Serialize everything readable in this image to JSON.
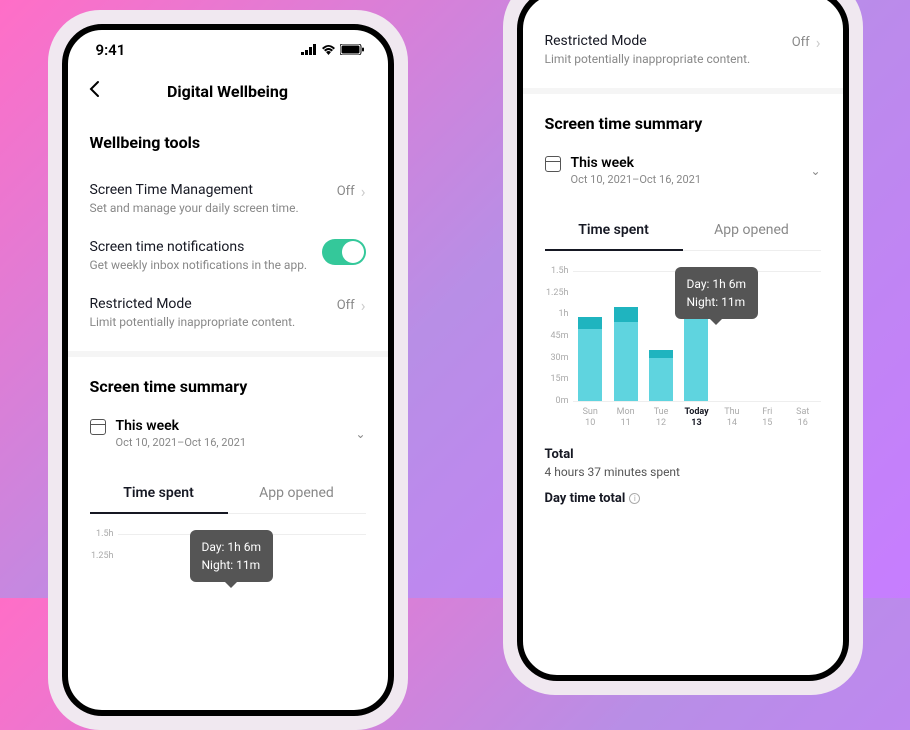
{
  "status": {
    "time": "9:41"
  },
  "header": {
    "title": "Digital Wellbeing"
  },
  "section_wellbeing": {
    "title": "Wellbeing tools",
    "items": {
      "screen_time_mgmt": {
        "label": "Screen Time Management",
        "desc": "Set and manage your daily screen time.",
        "value": "Off"
      },
      "notifications": {
        "label": "Screen time notifications",
        "desc": "Get weekly inbox notifications in the app."
      },
      "restricted": {
        "label": "Restricted Mode",
        "desc": "Limit potentially inappropriate content.",
        "value": "Off"
      }
    }
  },
  "summary": {
    "title": "Screen time summary",
    "period_label": "This week",
    "period_range": "Oct 10, 2021–Oct 16, 2021",
    "tabs": {
      "time_spent": "Time spent",
      "app_opened": "App opened"
    },
    "tooltip": {
      "day": "Day: 1h 6m",
      "night": "Night: 11m"
    },
    "totals": {
      "total_label": "Total",
      "total_value": "4 hours 37 minutes spent",
      "day_label": "Day time total"
    }
  },
  "chart_data": {
    "type": "bar",
    "title": "Time spent per day (stacked day/night, minutes)",
    "xlabel": "",
    "ylabel": "",
    "ylim": [
      0,
      90
    ],
    "y_ticks": [
      "0m",
      "15m",
      "30m",
      "45m",
      "1h",
      "1.25h",
      "1.5h"
    ],
    "categories": [
      "Sun 10",
      "Mon 11",
      "Tue 12",
      "Today 13",
      "Thu 14",
      "Fri 15",
      "Sat 16"
    ],
    "series": [
      {
        "name": "Day",
        "values": [
          50,
          55,
          30,
          66,
          0,
          0,
          0
        ]
      },
      {
        "name": "Night",
        "values": [
          8,
          10,
          5,
          11,
          0,
          0,
          0
        ]
      }
    ],
    "highlighted_index": 3,
    "highlighted_tooltip": {
      "day": "1h 6m",
      "night": "11m"
    }
  }
}
